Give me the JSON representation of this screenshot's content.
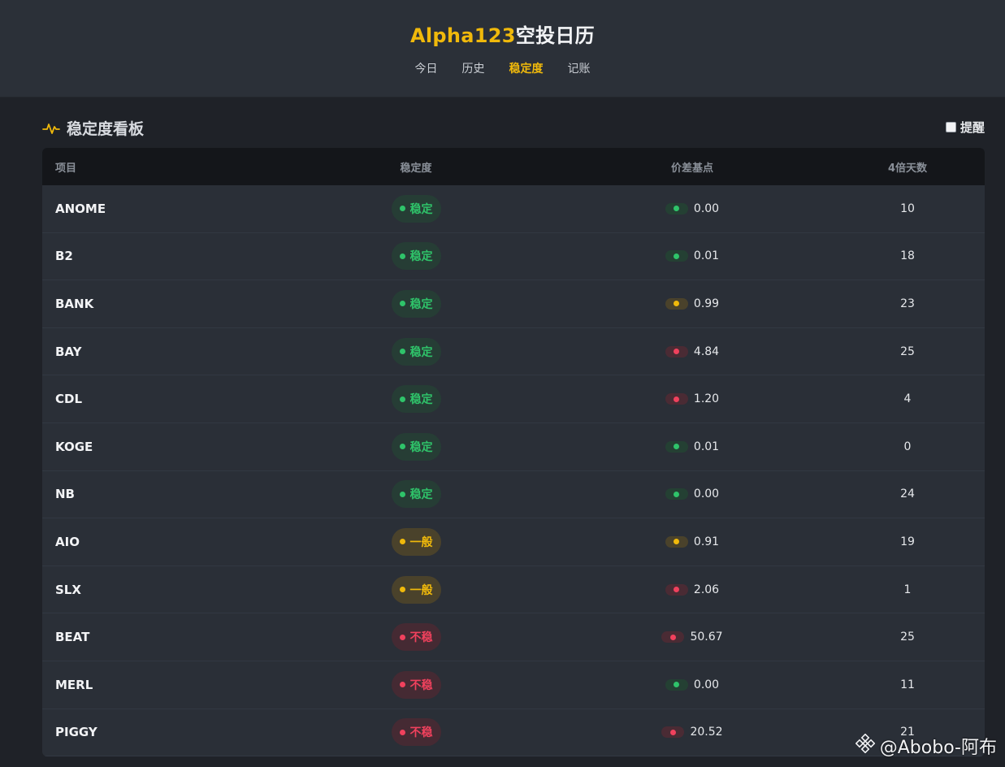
{
  "header": {
    "brand_accent": "Alpha123",
    "brand_rest": "空投日历",
    "nav": [
      {
        "label": "今日",
        "active": false
      },
      {
        "label": "历史",
        "active": false
      },
      {
        "label": "稳定度",
        "active": true
      },
      {
        "label": "记账",
        "active": false
      }
    ]
  },
  "panel": {
    "title": "稳定度看板",
    "remind_label": "提醒",
    "remind_checked": false
  },
  "table": {
    "columns": [
      "项目",
      "稳定度",
      "价差基点",
      "4倍天数"
    ],
    "rows": [
      {
        "name": "ANOME",
        "stability": "稳定",
        "level": "green",
        "spread": "0.00",
        "spread_level": "green",
        "days": "10"
      },
      {
        "name": "B2",
        "stability": "稳定",
        "level": "green",
        "spread": "0.01",
        "spread_level": "green",
        "days": "18"
      },
      {
        "name": "BANK",
        "stability": "稳定",
        "level": "green",
        "spread": "0.99",
        "spread_level": "yellow",
        "days": "23"
      },
      {
        "name": "BAY",
        "stability": "稳定",
        "level": "green",
        "spread": "4.84",
        "spread_level": "red",
        "days": "25"
      },
      {
        "name": "CDL",
        "stability": "稳定",
        "level": "green",
        "spread": "1.20",
        "spread_level": "red",
        "days": "4"
      },
      {
        "name": "KOGE",
        "stability": "稳定",
        "level": "green",
        "spread": "0.01",
        "spread_level": "green",
        "days": "0"
      },
      {
        "name": "NB",
        "stability": "稳定",
        "level": "green",
        "spread": "0.00",
        "spread_level": "green",
        "days": "24"
      },
      {
        "name": "AIO",
        "stability": "一般",
        "level": "yellow",
        "spread": "0.91",
        "spread_level": "yellow",
        "days": "19"
      },
      {
        "name": "SLX",
        "stability": "一般",
        "level": "yellow",
        "spread": "2.06",
        "spread_level": "red",
        "days": "1"
      },
      {
        "name": "BEAT",
        "stability": "不稳",
        "level": "red",
        "spread": "50.67",
        "spread_level": "red",
        "days": "25"
      },
      {
        "name": "MERL",
        "stability": "不稳",
        "level": "red",
        "spread": "0.00",
        "spread_level": "green",
        "days": "11"
      },
      {
        "name": "PIGGY",
        "stability": "不稳",
        "level": "red",
        "spread": "20.52",
        "spread_level": "red",
        "days": "21"
      }
    ]
  },
  "watermark": "@Abobo-阿布",
  "colors": {
    "accent": "#f0b90b",
    "green": "#2fc46a",
    "red": "#f0415d",
    "background": "#1f2228"
  }
}
